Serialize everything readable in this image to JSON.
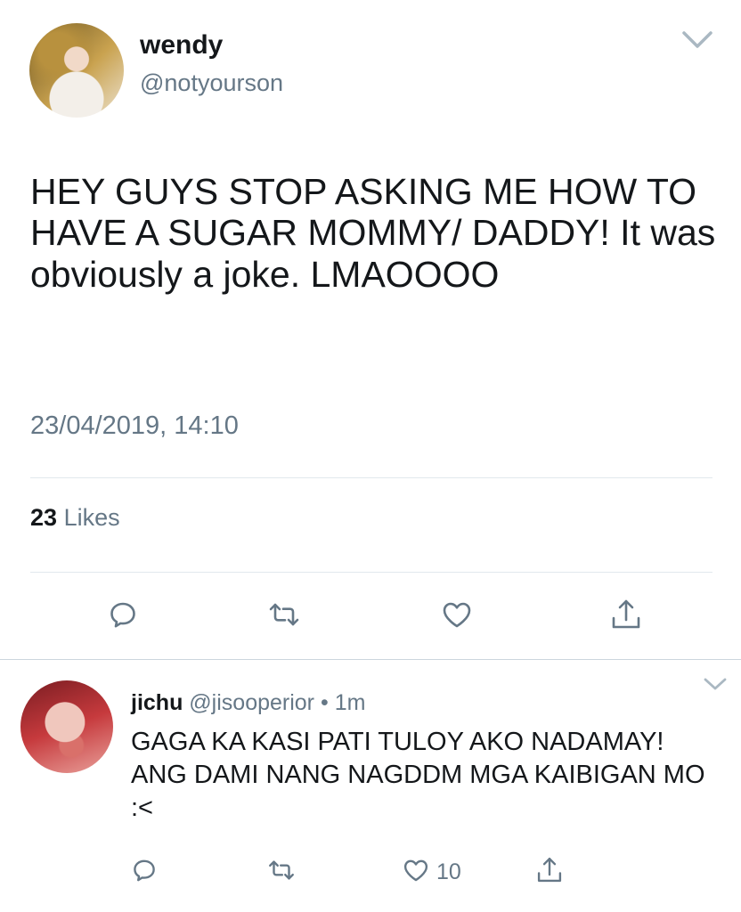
{
  "main_tweet": {
    "author_name": "wendy",
    "author_handle": "@notyourson",
    "text": "HEY GUYS STOP ASKING ME HOW TO HAVE A SUGAR MOMMY/ DADDY! It was obviously a joke. LMAOOOO",
    "timestamp": "23/04/2019, 14:10",
    "likes_count": "23",
    "likes_label": "Likes",
    "actions": [
      "reply-icon",
      "retweet-icon",
      "like-icon",
      "share-icon"
    ]
  },
  "reply": {
    "author_name": "jichu",
    "author_handle": "@jisooperior",
    "separator": "•",
    "time": "1m",
    "text": "GAGA KA KASI PATI TULOY AKO NADAMAY! ANG DAMI NANG NAGDDM MGA KAIBIGAN MO :<",
    "like_count": "10",
    "actions": [
      "reply-icon",
      "retweet-icon",
      "like-icon",
      "share-icon"
    ]
  },
  "colors": {
    "text": "#14171a",
    "secondary": "#657786",
    "divider": "#e1e8ed"
  }
}
